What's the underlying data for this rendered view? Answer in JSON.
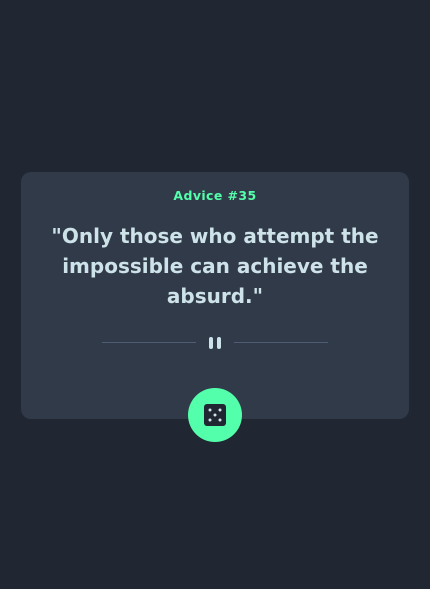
{
  "advice": {
    "id_label": "Advice #35",
    "text": "\"Only those who attempt the impossible can achieve the absurd.\""
  },
  "icons": {
    "divider": "pause-icon",
    "button": "dice-icon"
  },
  "colors": {
    "background": "#202632",
    "card": "#313a49",
    "accent": "#53ffaa",
    "text": "#cee3e9",
    "divider": "#4f5d74"
  }
}
